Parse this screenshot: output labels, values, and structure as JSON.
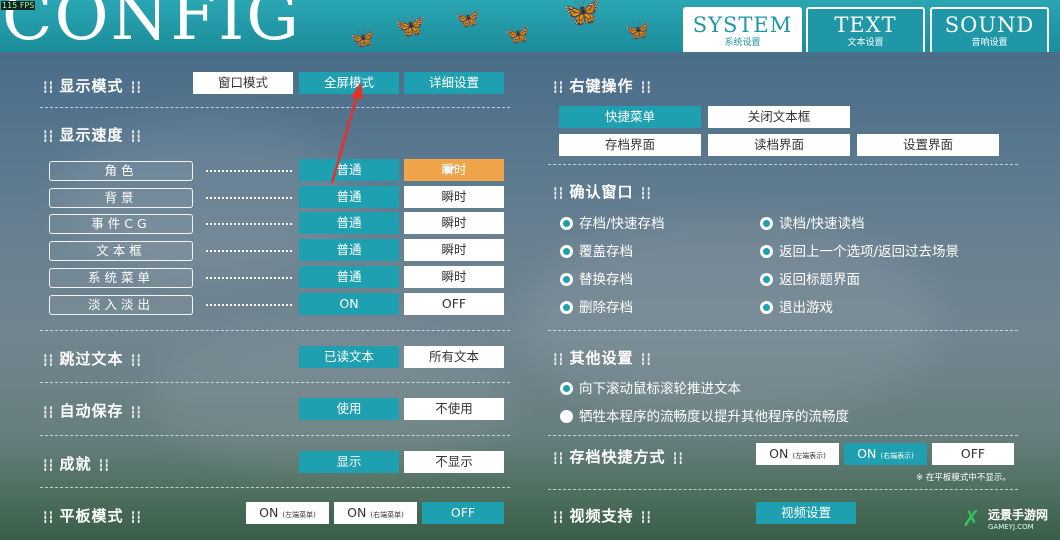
{
  "fps": "115 FPS",
  "header": {
    "logo": "CONFIG"
  },
  "tabs": [
    {
      "en": "SYSTEM",
      "cn": "系统设置",
      "active": true
    },
    {
      "en": "TEXT",
      "cn": "文本设置"
    },
    {
      "en": "SOUND",
      "cn": "音响设置"
    }
  ],
  "display_mode": {
    "title": "显示模式",
    "buttons": [
      "窗口模式",
      "全屏模式",
      "详细设置"
    ]
  },
  "display_speed": {
    "title": "显示速度",
    "rows": [
      {
        "label": "角色",
        "normal": "普通",
        "instant": "瞬时"
      },
      {
        "label": "背景",
        "normal": "普通",
        "instant": "瞬时"
      },
      {
        "label": "事件CG",
        "normal": "普通",
        "instant": "瞬时"
      },
      {
        "label": "文本框",
        "normal": "普通",
        "instant": "瞬时"
      },
      {
        "label": "系统菜单",
        "normal": "普通",
        "instant": "瞬时"
      },
      {
        "label": "淡入淡出",
        "normal": "ON",
        "instant": "OFF"
      }
    ]
  },
  "skip_text": {
    "title": "跳过文本",
    "options": [
      "已读文本",
      "所有文本"
    ]
  },
  "auto_save": {
    "title": "自动保存",
    "options": [
      "使用",
      "不使用"
    ]
  },
  "achievement": {
    "title": "成就",
    "options": [
      "显示",
      "不显示"
    ]
  },
  "tablet_mode": {
    "title": "平板模式",
    "options": [
      {
        "main": "ON",
        "sub": "(左端菜单)"
      },
      {
        "main": "ON",
        "sub": "(右端菜单)"
      },
      {
        "main": "OFF",
        "sub": ""
      }
    ]
  },
  "right_click": {
    "title": "右键操作",
    "buttons": [
      "快捷菜单",
      "关闭文本框",
      "存档界面",
      "读档界面",
      "设置界面"
    ]
  },
  "confirm": {
    "title": "确认窗口",
    "items": [
      "存档/快速存档",
      "读档/快速读档",
      "覆盖存档",
      "返回上一个选项/返回过去场景",
      "替换存档",
      "返回标题界面",
      "删除存档",
      "退出游戏"
    ]
  },
  "other": {
    "title": "其他设置",
    "items": [
      "向下滚动鼠标滚轮推进文本",
      "牺牲本程序的流畅度以提升其他程序的流畅度"
    ]
  },
  "save_shortcut": {
    "title": "存档快捷方式",
    "options": [
      {
        "main": "ON",
        "sub": "(左端表示)"
      },
      {
        "main": "ON",
        "sub": "(右端表示)"
      },
      {
        "main": "OFF",
        "sub": ""
      }
    ],
    "note": "※ 在平板模式中不显示。"
  },
  "video": {
    "title": "视频支持",
    "button": "视频设置"
  },
  "watermark": {
    "name": "远景手游网",
    "url": "GAMEYJ.COM"
  },
  "colors": {
    "accent": "#1ea0b0",
    "selected": "#f0a44a",
    "annotation": "#e8302a"
  }
}
